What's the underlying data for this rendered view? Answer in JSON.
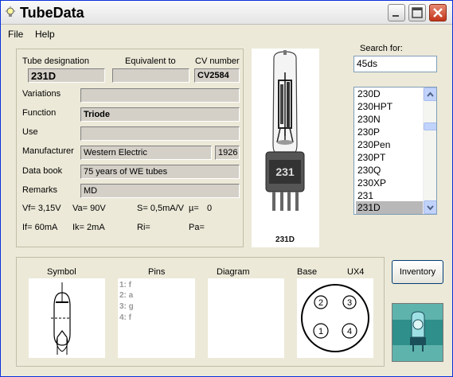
{
  "window": {
    "title": "TubeData"
  },
  "menu": {
    "file": "File",
    "help": "Help"
  },
  "info": {
    "designation_label": "Tube designation",
    "equivalent_label": "Equivalent to",
    "cv_label": "CV number",
    "designation": "231D",
    "equivalent": "",
    "cv": "CV2584",
    "variations_label": "Variations",
    "variations": "",
    "function_label": "Function",
    "function": "Triode",
    "use_label": "Use",
    "use": "",
    "manufacturer_label": "Manufacturer",
    "manufacturer": "Western Electric",
    "year": "1926",
    "databook_label": "Data book",
    "databook": "75 years of WE tubes",
    "remarks_label": "Remarks",
    "remarks": "MD",
    "vf": "Vf= 3,15V",
    "va": "Va= 90V",
    "s": "S= 0,5mA/V",
    "mu": "µ=",
    "mu_val": "0",
    "if": "If= 60mA",
    "ik": "Ik= 2mA",
    "ri": "Ri=",
    "pa": "Pa="
  },
  "photo": {
    "caption": "231D",
    "glass_print": "231"
  },
  "search": {
    "label": "Search for:",
    "value": "45ds"
  },
  "list": {
    "items": [
      "230D",
      "230HPT",
      "230N",
      "230P",
      "230Pen",
      "230PT",
      "230Q",
      "230XP",
      "231",
      "231D"
    ],
    "selected": "231D"
  },
  "bottom": {
    "symbol_label": "Symbol",
    "pins_label": "Pins",
    "diagram_label": "Diagram",
    "base_label": "Base",
    "base_type": "UX4",
    "pins": [
      "1: f",
      "2: a",
      "3: g",
      "4: f"
    ],
    "base_pins": [
      "2",
      "3",
      "1",
      "4"
    ]
  },
  "buttons": {
    "inventory": "Inventory"
  },
  "colors": {
    "window_bg": "#ece9d8",
    "close_button": "#c2351a",
    "selection": "#b8b8b8",
    "logo_bg": "#2f8f8a"
  }
}
